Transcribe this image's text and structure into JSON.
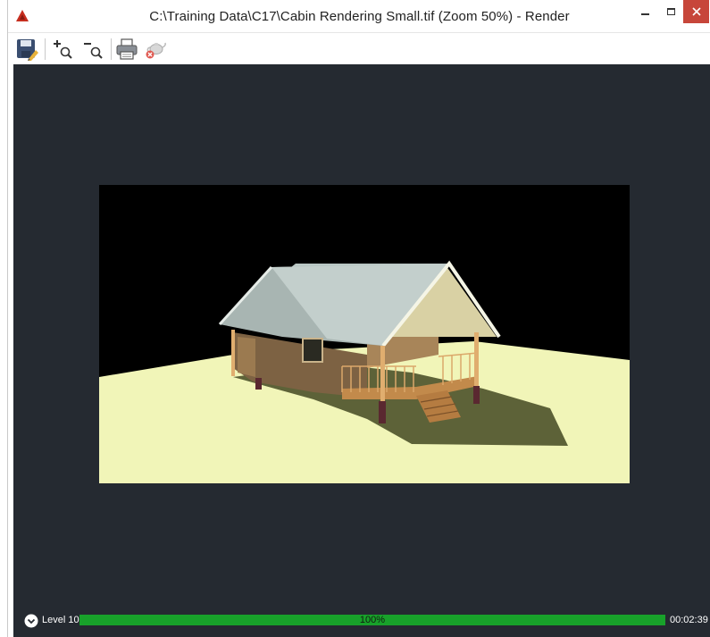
{
  "window": {
    "title": "C:\\Training Data\\C17\\Cabin Rendering Small.tif (Zoom 50%) - Render",
    "controls": {
      "minimize_icon": "minimize-icon",
      "maximize_icon": "maximize-icon",
      "close_icon": "close-icon"
    }
  },
  "toolbar": {
    "buttons": [
      {
        "name": "save-button",
        "icon": "save-icon"
      },
      {
        "name": "zoom-in-button",
        "icon": "zoom-in-icon"
      },
      {
        "name": "zoom-out-button",
        "icon": "zoom-out-icon"
      },
      {
        "name": "print-button",
        "icon": "print-icon"
      },
      {
        "name": "cancel-render-button",
        "icon": "teapot-cancel-icon"
      }
    ]
  },
  "render": {
    "image_subject": "cabin-rendering"
  },
  "status": {
    "level_label": "Level 10",
    "progress_value": 1.0,
    "progress_label": "100%",
    "elapsed_time": "00:02:39"
  },
  "colors": {
    "canvas_background": "#252a31",
    "progress_green": "#1f9e27",
    "close_button": "#c7463a",
    "app_icon_red": "#c62e1f"
  }
}
